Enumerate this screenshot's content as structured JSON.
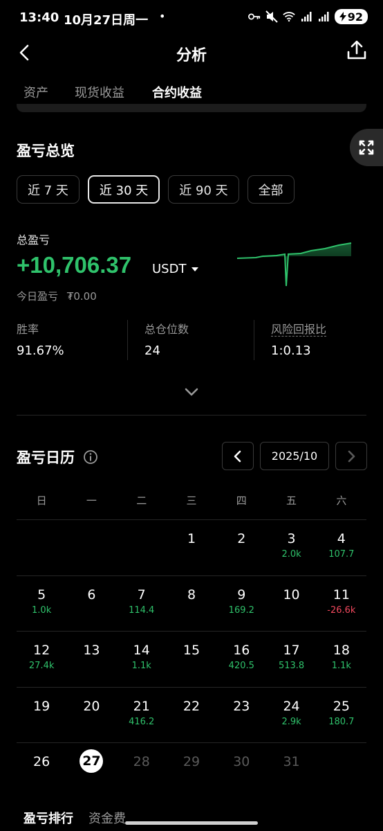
{
  "status_bar": {
    "time": "13:40",
    "date": "10月27日周一",
    "dot": "•",
    "battery": "92"
  },
  "header": {
    "title": "分析"
  },
  "tabs": [
    {
      "label": "资产"
    },
    {
      "label": "现货收益"
    },
    {
      "label": "合约收益"
    }
  ],
  "overview": {
    "title": "盈亏总览",
    "ranges": [
      "近 7 天",
      "近 30 天",
      "近 90 天",
      "全部"
    ],
    "total_label": "总盈亏",
    "total_value": "+10,706.37",
    "unit": "USDT",
    "today_label": "今日盈亏",
    "today_value": "₮0.00",
    "stats": [
      {
        "label": "胜率",
        "value": "91.67%"
      },
      {
        "label": "总仓位数",
        "value": "24"
      },
      {
        "label": "风险回报比",
        "value": "1:0.13"
      }
    ]
  },
  "calendar": {
    "title": "盈亏日历",
    "month": "2025/10",
    "weekdays": [
      "日",
      "一",
      "二",
      "三",
      "四",
      "五",
      "六"
    ],
    "rows": [
      [
        {
          "d": "",
          "p": ""
        },
        {
          "d": "",
          "p": ""
        },
        {
          "d": "",
          "p": ""
        },
        {
          "d": "1",
          "p": ""
        },
        {
          "d": "2",
          "p": ""
        },
        {
          "d": "3",
          "p": "2.0k"
        },
        {
          "d": "4",
          "p": "107.7"
        }
      ],
      [
        {
          "d": "5",
          "p": "1.0k"
        },
        {
          "d": "6",
          "p": ""
        },
        {
          "d": "7",
          "p": "114.4"
        },
        {
          "d": "8",
          "p": ""
        },
        {
          "d": "9",
          "p": "169.2"
        },
        {
          "d": "10",
          "p": ""
        },
        {
          "d": "11",
          "p": "-26.6k"
        }
      ],
      [
        {
          "d": "12",
          "p": "27.4k"
        },
        {
          "d": "13",
          "p": ""
        },
        {
          "d": "14",
          "p": "1.1k"
        },
        {
          "d": "15",
          "p": ""
        },
        {
          "d": "16",
          "p": "420.5"
        },
        {
          "d": "17",
          "p": "513.8"
        },
        {
          "d": "18",
          "p": "1.1k"
        }
      ],
      [
        {
          "d": "19",
          "p": ""
        },
        {
          "d": "20",
          "p": ""
        },
        {
          "d": "21",
          "p": "416.2"
        },
        {
          "d": "22",
          "p": ""
        },
        {
          "d": "23",
          "p": ""
        },
        {
          "d": "24",
          "p": "2.9k"
        },
        {
          "d": "25",
          "p": "180.7"
        }
      ],
      [
        {
          "d": "26",
          "p": ""
        },
        {
          "d": "27",
          "p": "",
          "today": true
        },
        {
          "d": "28",
          "p": "",
          "future": true
        },
        {
          "d": "29",
          "p": "",
          "future": true
        },
        {
          "d": "30",
          "p": "",
          "future": true
        },
        {
          "d": "31",
          "p": "",
          "future": true
        },
        {
          "d": "",
          "p": ""
        }
      ]
    ]
  },
  "bottom_tabs": [
    "盈亏排行",
    "资金费"
  ],
  "colors": {
    "positive": "#2fc26b",
    "negative": "#f2495e",
    "background": "#000000"
  },
  "icons": [
    "back-arrow-icon",
    "share-icon",
    "expand-icon",
    "info-icon",
    "chevron-left-icon",
    "chevron-right-icon",
    "chevron-down-icon",
    "caret-down-icon"
  ]
}
